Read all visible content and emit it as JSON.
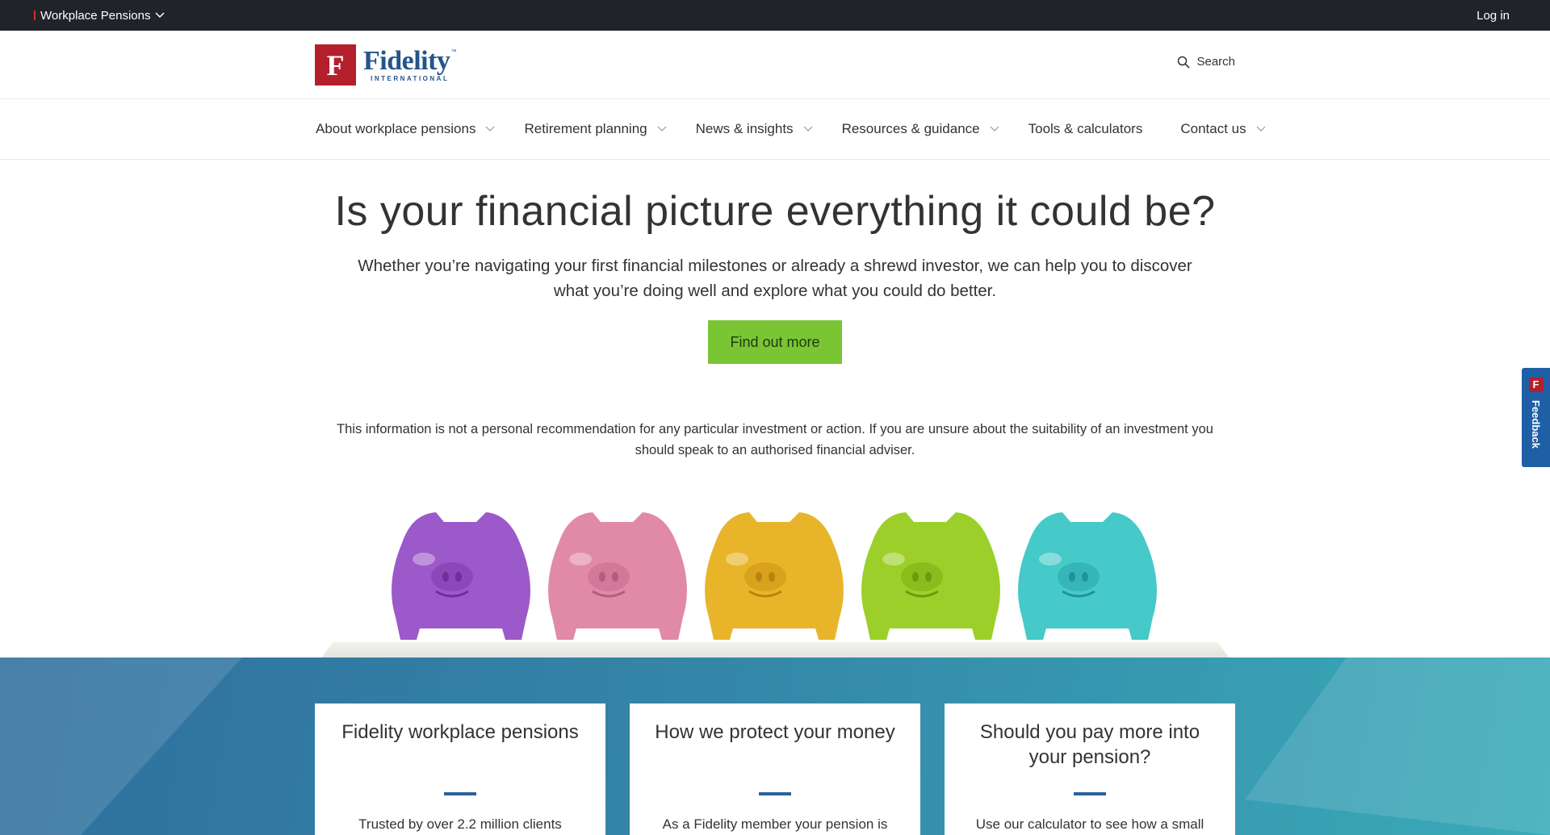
{
  "topbar": {
    "site_switcher_label": "Workplace Pensions",
    "login_label": "Log in"
  },
  "header": {
    "logo_word": "Fidelity",
    "logo_sub": "INTERNATIONAL",
    "logo_tm": "™",
    "logo_mark": "F",
    "search_label": "Search"
  },
  "nav": {
    "items": [
      {
        "label": "About workplace pensions",
        "has_dropdown": true
      },
      {
        "label": "Retirement planning",
        "has_dropdown": true
      },
      {
        "label": "News & insights",
        "has_dropdown": true
      },
      {
        "label": "Resources & guidance",
        "has_dropdown": true
      },
      {
        "label": "Tools & calculators",
        "has_dropdown": false
      },
      {
        "label": "Contact us",
        "has_dropdown": true
      }
    ]
  },
  "hero": {
    "title": "Is your financial picture everything it could be?",
    "lead": "Whether you’re navigating your first financial milestones or already a shrewd investor, we can help you to discover what you’re doing well and explore what you could do better.",
    "cta_label": "Find out more",
    "disclaimer": "This information is not a personal recommendation for any particular investment or action. If you are unsure about the suitability of an investment you should speak to an authorised financial adviser."
  },
  "banner": {
    "pig_colors": [
      "#9b59c9",
      "#e08aa8",
      "#e8b52a",
      "#9ccf2a",
      "#45c9c9"
    ]
  },
  "feedback": {
    "label": "Feedback",
    "mark": "F"
  },
  "cards": [
    {
      "title": "Fidelity workplace pensions",
      "text": "Trusted by over 2.2 million clients"
    },
    {
      "title": "How we protect your money",
      "text": "As a Fidelity member your pension is"
    },
    {
      "title": "Should you pay more into your pension?",
      "text": "Use our calculator to see how a small"
    }
  ],
  "colors": {
    "topbar": "#20232a",
    "brand_red": "#b3202c",
    "brand_blue": "#24548c",
    "cta_green": "#7ac533",
    "feedback_blue": "#1f5fa5"
  }
}
